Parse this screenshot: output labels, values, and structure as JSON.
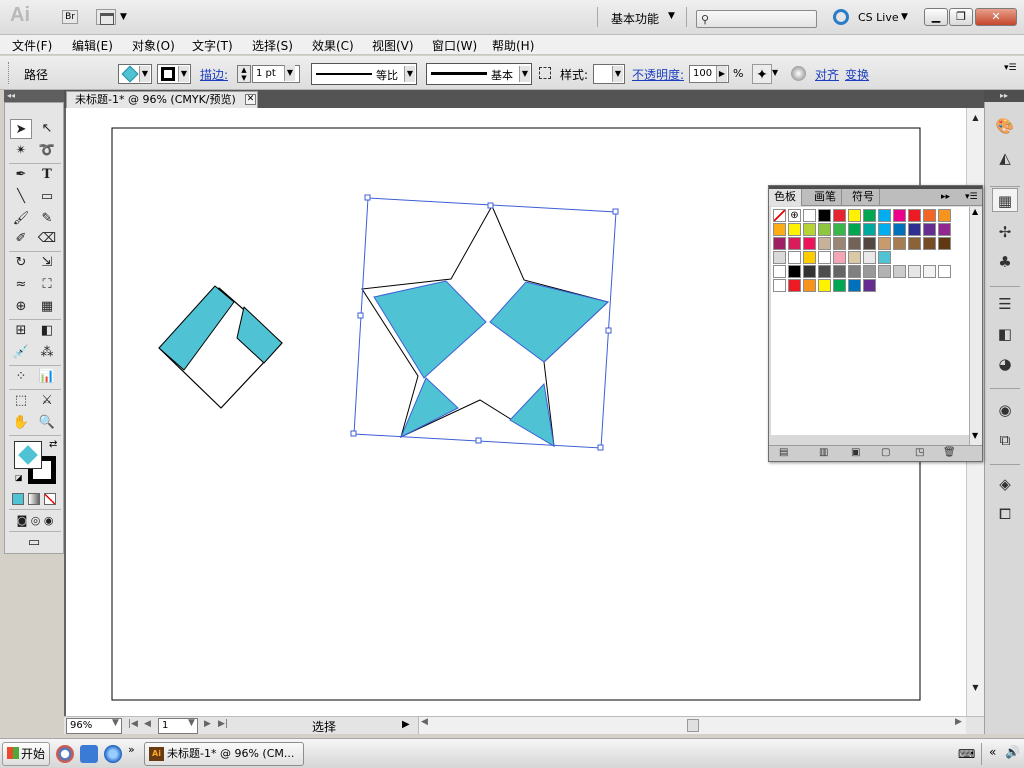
{
  "app": {
    "logo": "Ai",
    "bridge": "Br",
    "workspace": "基本功能",
    "cs_live": "CS Live"
  },
  "menu": [
    "文件(F)",
    "编辑(E)",
    "对象(O)",
    "文字(T)",
    "选择(S)",
    "效果(C)",
    "视图(V)",
    "窗口(W)",
    "帮助(H)"
  ],
  "control": {
    "path_label": "路径",
    "stroke_label": "描边:",
    "stroke_weight": "1 pt",
    "profile": "等比",
    "brush": "基本",
    "style_label": "样式:",
    "opacity_label": "不透明度:",
    "opacity_value": "100",
    "opacity_unit": "%",
    "align_label": "对齐",
    "transform_label": "变换"
  },
  "document": {
    "tab_title": "未标题-1* @ 96% (CMYK/预览)",
    "zoom": "96%",
    "page": "1",
    "status": "选择"
  },
  "swatches_panel": {
    "tabs": [
      "色板",
      "画笔",
      "符号"
    ],
    "active_tab": "色板",
    "rows": [
      [
        "#ffffff",
        "#ffffff",
        "#ffffff",
        "#000000",
        "#e8252e",
        "#fff100",
        "#00a651",
        "#00aeef",
        "#ec008c",
        "#ed1c24",
        "#f26522",
        "#f7941d"
      ],
      [
        "#fbad18",
        "#fff200",
        "#b5d334",
        "#8dc63f",
        "#39b54a",
        "#00a651",
        "#00a99d",
        "#00aeef",
        "#0072bc",
        "#2e3192",
        "#662d91",
        "#92278f"
      ],
      [
        "#9e1f63",
        "#d91c5c",
        "#ed145b",
        "#c7b299",
        "#998675",
        "#736357",
        "#534741",
        "#c69c6d",
        "#a67c52",
        "#8c6239",
        "#754c24",
        "#603913"
      ],
      [
        "#d9d9d9",
        "#ffffff",
        "#ffcc00",
        "#ffffff",
        "#f4a6b6",
        "#d9c9a6",
        "#e9e9e9",
        "#4fc3d4"
      ],
      [
        "#ffffff",
        "#000000",
        "#333333",
        "#4d4d4d",
        "#666666",
        "#808080",
        "#999999",
        "#b3b3b3",
        "#cccccc",
        "#e6e6e6",
        "#f2f2f2",
        "#ffffff"
      ],
      [
        "#ffffff",
        "#ed1c24",
        "#f7941d",
        "#fff200",
        "#00a651",
        "#0072bc",
        "#662d91"
      ]
    ]
  },
  "taskbar": {
    "start": "开始",
    "task_label": "未标题-1* @ 96% (CM...",
    "task_icon": "Ai"
  },
  "colors": {
    "shape_fill": "#4fc3d4",
    "selection": "#3d5fd6"
  }
}
